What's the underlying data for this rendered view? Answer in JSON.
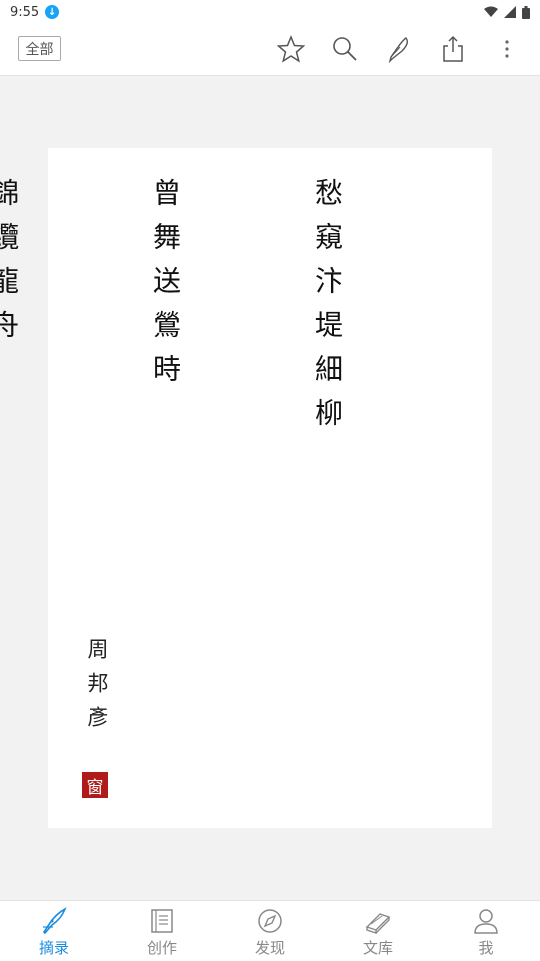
{
  "status_bar": {
    "time": "9:55"
  },
  "toolbar": {
    "filter_label": "全部",
    "icons": [
      "star-icon",
      "search-icon",
      "pen-icon",
      "share-icon",
      "more-icon"
    ]
  },
  "card": {
    "poem_lines": [
      "愁窺汴堤細柳",
      "曾舞送鶯時",
      "錦纜龍舟"
    ],
    "author": "周邦彥",
    "seal": "窗"
  },
  "bottom_nav": {
    "items": [
      {
        "label": "摘录",
        "icon": "quill-icon",
        "active": true
      },
      {
        "label": "创作",
        "icon": "notebook-icon",
        "active": false
      },
      {
        "label": "发现",
        "icon": "compass-icon",
        "active": false
      },
      {
        "label": "文库",
        "icon": "books-icon",
        "active": false
      },
      {
        "label": "我",
        "icon": "person-icon",
        "active": false
      }
    ]
  },
  "colors": {
    "accent": "#1a8ce0",
    "seal": "#b01a1a",
    "background": "#f2f2f2"
  }
}
